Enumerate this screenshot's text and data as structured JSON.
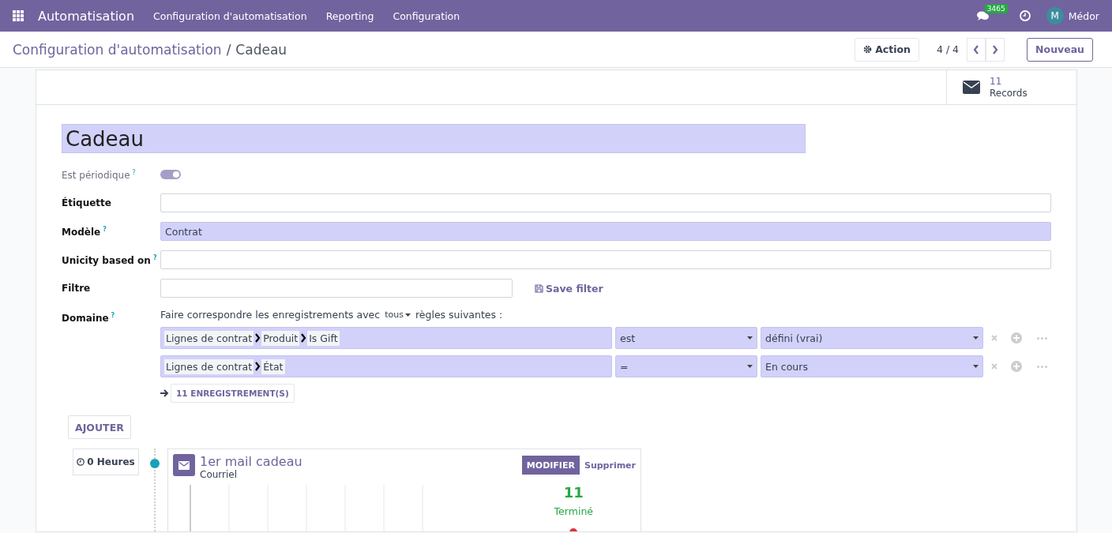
{
  "navbar": {
    "app": "Automatisation",
    "menus": [
      "Configuration d'automatisation",
      "Reporting",
      "Configuration"
    ],
    "chat_count": "3465",
    "user_initial": "M",
    "user_name": "Médor"
  },
  "control_panel": {
    "breadcrumb": "Configuration d'automatisation",
    "separator": "/",
    "current": "Cadeau",
    "action": "Action",
    "pager": "4 / 4",
    "new": "Nouveau"
  },
  "stat_button": {
    "value": "11",
    "label": "Records"
  },
  "form": {
    "name": "Cadeau",
    "periodic": {
      "label": "Est périodique",
      "tooltip": "?",
      "on": true
    },
    "fields": [
      {
        "label": "Étiquette",
        "required": false
      },
      {
        "label": "Modèle",
        "value": "Contrat",
        "tooltip": "?",
        "required": true
      },
      {
        "label": "Unicity based on",
        "tooltip": "?",
        "required": false
      }
    ],
    "filter": {
      "label": "Filtre",
      "save": "Save filter"
    },
    "domain": {
      "label": "Domaine",
      "tooltip": "?",
      "intro": "Faire correspondre les enregistrements avec",
      "match": "tous",
      "suffix": "règles suivantes :",
      "rules": [
        {
          "path": [
            "Lignes de contrat",
            "Produit",
            "Is Gift"
          ],
          "operator": "est",
          "value": "défini (vrai)"
        },
        {
          "path": [
            "Lignes de contrat",
            "État"
          ],
          "operator": "=",
          "value": "En cours"
        }
      ],
      "records": "11 ENREGISTREMENT(S)"
    }
  },
  "add_button": "AJOUTER",
  "activity": {
    "delay": "0 Heures",
    "title": "1er mail cadeau",
    "type": "Courriel",
    "edit": "MODIFIER",
    "delete": "Supprimer",
    "count": "11",
    "status": "Terminé"
  }
}
